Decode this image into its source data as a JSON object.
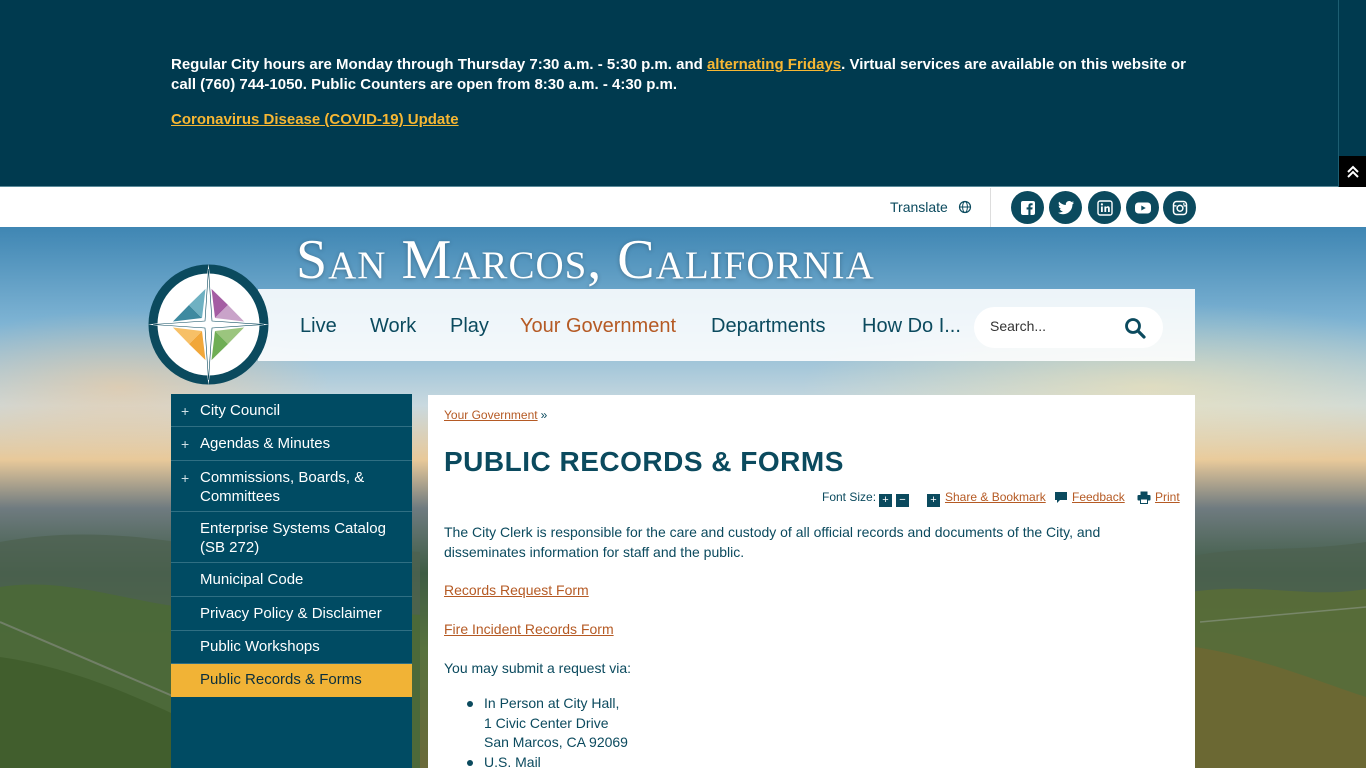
{
  "alert": {
    "line_part1": "Regular City hours are Monday through Thursday 7:30 a.m. - 5:30 p.m. and ",
    "fridays_link": "alternating Fridays",
    "line_part2": ". Virtual services are available on this website or call (760) 744-1050. Public Counters are open from 8:30 a.m. - 4:30 p.m.",
    "covid_link": "Coronavirus Disease (COVID-19) Update",
    "collapse_icon": "double-chevron-up-icon"
  },
  "utility": {
    "translate_label": "Translate",
    "social": [
      "facebook-icon",
      "twitter-icon",
      "linkedin-icon",
      "youtube-icon",
      "instagram-icon"
    ]
  },
  "site": {
    "title": "San Marcos, California"
  },
  "nav": {
    "items": [
      "Live",
      "Work",
      "Play",
      "Your Government",
      "Departments",
      "How Do I..."
    ],
    "active": "Your Government",
    "search_placeholder": "Search..."
  },
  "sidebar": {
    "items": [
      {
        "label": "City Council",
        "expandable": true
      },
      {
        "label": "Agendas & Minutes",
        "expandable": true
      },
      {
        "label": "Commissions, Boards, & Committees",
        "expandable": true
      },
      {
        "label": "Enterprise Systems Catalog (SB 272)",
        "expandable": false
      },
      {
        "label": "Municipal Code",
        "expandable": false
      },
      {
        "label": "Privacy Policy & Disclaimer",
        "expandable": false
      },
      {
        "label": "Public Workshops",
        "expandable": false
      },
      {
        "label": "Public Records & Forms",
        "expandable": false,
        "current": true
      }
    ]
  },
  "content": {
    "breadcrumb": "Your Government",
    "breadcrumb_sep": "»",
    "title": "PUBLIC RECORDS & FORMS",
    "tools": {
      "font_size_label": "Font Size:",
      "increase": "+",
      "decrease": "−",
      "share_label": "Share & Bookmark",
      "feedback_label": "Feedback",
      "print_label": "Print"
    },
    "intro": "The City Clerk is responsible for the care and custody of all official records and documents of the City, and disseminates information for staff and the public.",
    "records_request_link": "Records Request Form",
    "fire_incident_link": "Fire Incident Records Form",
    "submit_intro": "You may submit a request via:",
    "methods": [
      {
        "line1": "In Person at City Hall,",
        "line2": "1 Civic Center Drive",
        "line3": "San Marcos, CA 92069"
      },
      {
        "line1": "U.S. Mail"
      }
    ]
  },
  "colors": {
    "primary": "#004b63",
    "banner": "#003a4f",
    "accent": "#f1b336",
    "link": "#b55a24"
  }
}
